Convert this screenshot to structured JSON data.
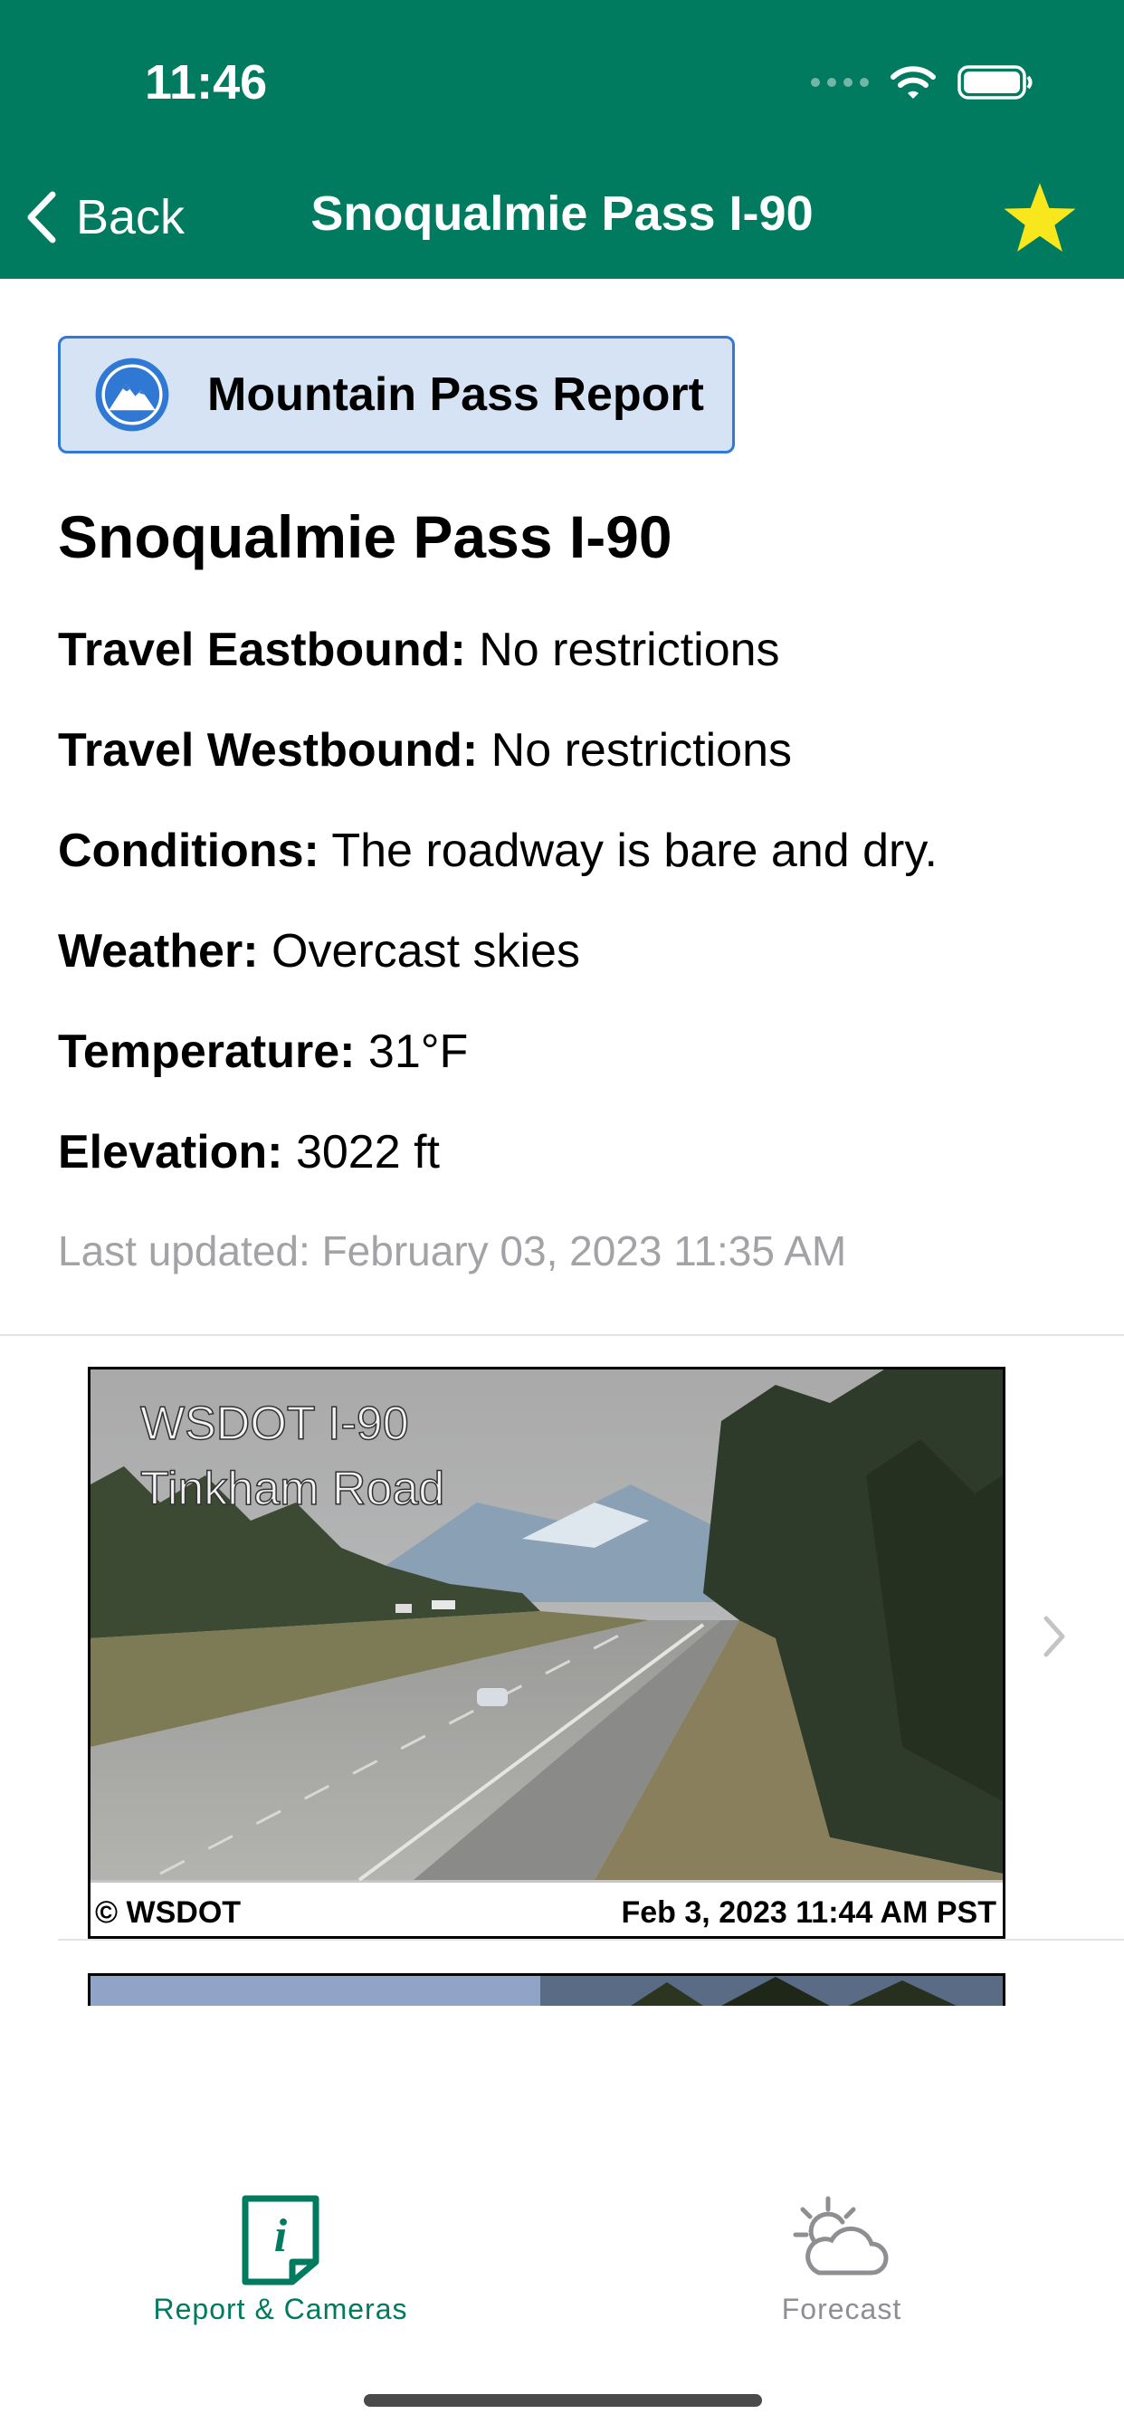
{
  "status_bar": {
    "time": "11:46"
  },
  "nav": {
    "back_label": "Back",
    "title": "Snoqualmie Pass I-90"
  },
  "report_button": {
    "label": "Mountain Pass Report"
  },
  "pass": {
    "title": "Snoqualmie Pass I-90",
    "details": [
      {
        "key": "Travel Eastbound:",
        "value": "No restrictions"
      },
      {
        "key": "Travel Westbound:",
        "value": "No restrictions"
      },
      {
        "key": "Conditions:",
        "value": "The roadway is bare and dry."
      },
      {
        "key": "Weather:",
        "value": "Overcast skies"
      },
      {
        "key": "Temperature:",
        "value": "31°F"
      },
      {
        "key": "Elevation:",
        "value": "3022 ft"
      }
    ],
    "last_updated": "Last updated: February 03, 2023 11:35 AM"
  },
  "cameras": [
    {
      "overlay_line1": "WSDOT   I-90",
      "overlay_line2": "Tinkham Road",
      "footer_left": "© WSDOT",
      "footer_right": "Feb 3, 2023 11:44 AM PST"
    }
  ],
  "tabs": [
    {
      "label": "Report & Cameras",
      "icon": "info-icon",
      "active": true
    },
    {
      "label": "Forecast",
      "icon": "cloud-sun-icon",
      "active": false
    }
  ],
  "colors": {
    "header": "#007B5F",
    "star": "#F8E71C",
    "button_bg": "#D5E3F5",
    "button_border": "#3278D6"
  }
}
